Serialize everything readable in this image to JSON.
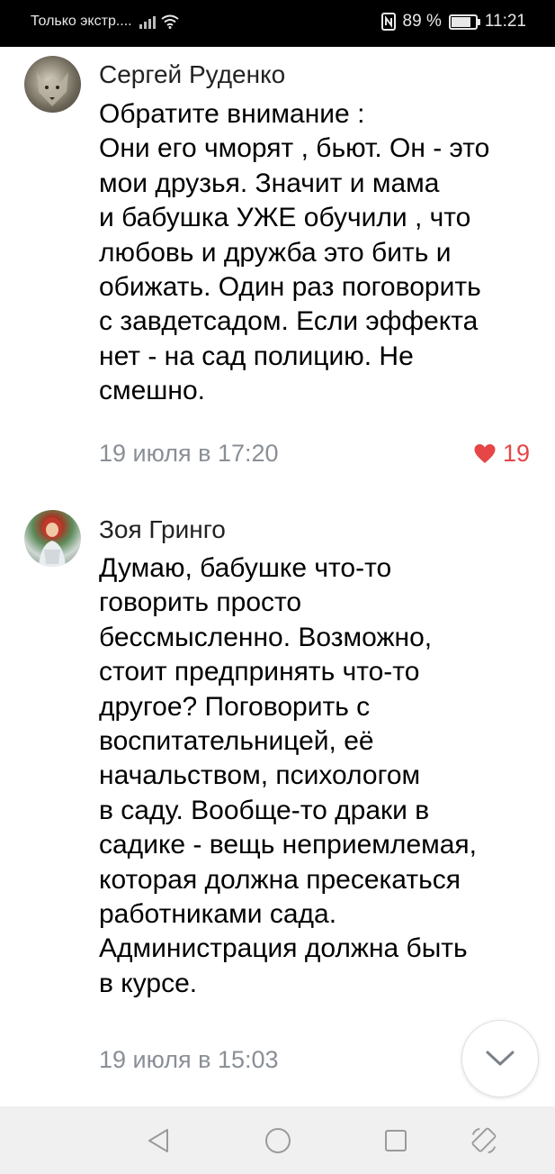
{
  "status_bar": {
    "carrier": "Только экстр....",
    "battery_percent": "89 %",
    "battery_level": 0.89,
    "time": "11:21",
    "icons": [
      "signal-icon",
      "wifi-icon",
      "nfc-icon",
      "battery-icon"
    ]
  },
  "comments": [
    {
      "author": "Сергей Руденко",
      "text": "Обратите внимание :\nОни его чморят , бьют. Он - это\nмои друзья. Значит и мама\nи бабушка УЖЕ обучили , что\nлюбовь и дружба это бить и\nобижать. Один раз поговорить\nс завдетсадом. Если эффекта\nнет - на сад полицию. Не\nсмешно.",
      "time": "19 июля в 17:20",
      "likes": "19"
    },
    {
      "author": "Зоя Гринго",
      "text": "Думаю, бабушке что-то\nговорить просто\nбессмысленно. Возможно,\nстоит предпринять что-то\nдругое? Поговорить с\nвоспитательницей, её\nначальством, психологом\nв саду. Вообще-то драки в\nсадике - вещь неприемлемая,\nкоторая должна пресекаться\nработниками сада.\nАдминистрация должна быть\nв курсе.",
      "time": "19 июля в 15:03"
    }
  ],
  "colors": {
    "like": "#e64646",
    "meta": "#8a8f96",
    "text": "#000000"
  }
}
